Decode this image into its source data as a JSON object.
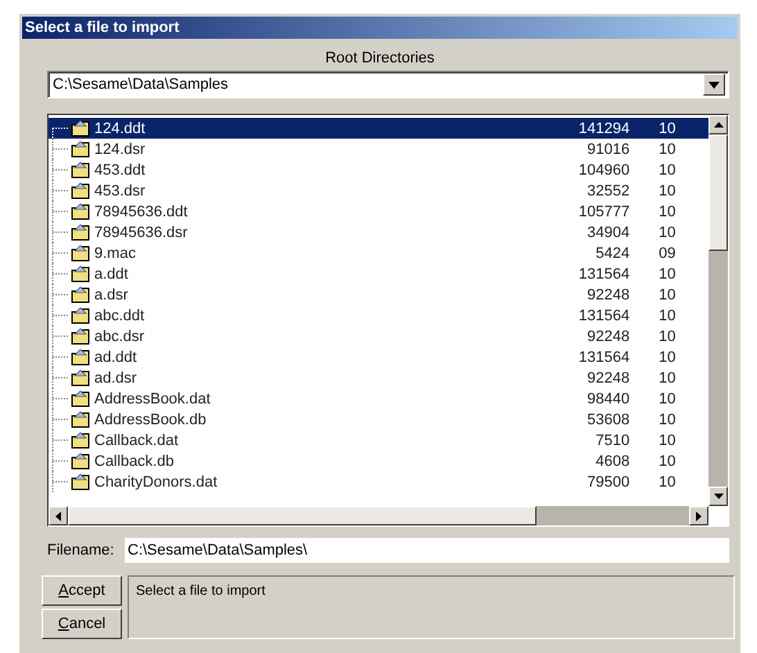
{
  "window": {
    "title": "Select a file to import"
  },
  "root_directories": {
    "label": "Root Directories",
    "value": "C:\\Sesame\\Data\\Samples"
  },
  "files": [
    {
      "name": "124.ddt",
      "size": "141294",
      "column_3": "10",
      "selected": true
    },
    {
      "name": "124.dsr",
      "size": "91016",
      "column_3": "10",
      "selected": false
    },
    {
      "name": "453.ddt",
      "size": "104960",
      "column_3": "10",
      "selected": false
    },
    {
      "name": "453.dsr",
      "size": "32552",
      "column_3": "10",
      "selected": false
    },
    {
      "name": "78945636.ddt",
      "size": "105777",
      "column_3": "10",
      "selected": false
    },
    {
      "name": "78945636.dsr",
      "size": "34904",
      "column_3": "10",
      "selected": false
    },
    {
      "name": "9.mac",
      "size": "5424",
      "column_3": "09",
      "selected": false
    },
    {
      "name": "a.ddt",
      "size": "131564",
      "column_3": "10",
      "selected": false
    },
    {
      "name": "a.dsr",
      "size": "92248",
      "column_3": "10",
      "selected": false
    },
    {
      "name": "abc.ddt",
      "size": "131564",
      "column_3": "10",
      "selected": false
    },
    {
      "name": "abc.dsr",
      "size": "92248",
      "column_3": "10",
      "selected": false
    },
    {
      "name": "ad.ddt",
      "size": "131564",
      "column_3": "10",
      "selected": false
    },
    {
      "name": "ad.dsr",
      "size": "92248",
      "column_3": "10",
      "selected": false
    },
    {
      "name": "AddressBook.dat",
      "size": "98440",
      "column_3": "10",
      "selected": false
    },
    {
      "name": "AddressBook.db",
      "size": "53608",
      "column_3": "10",
      "selected": false
    },
    {
      "name": "Callback.dat",
      "size": "7510",
      "column_3": "10",
      "selected": false
    },
    {
      "name": "Callback.db",
      "size": "4608",
      "column_3": "10",
      "selected": false
    },
    {
      "name": "CharityDonors.dat",
      "size": "79500",
      "column_3": "10",
      "selected": false
    }
  ],
  "filename": {
    "label": "Filename:",
    "value": "C:\\Sesame\\Data\\Samples\\"
  },
  "buttons": [
    {
      "label": "Accept"
    },
    {
      "label": "Cancel"
    }
  ],
  "message": "Select a file to import"
}
